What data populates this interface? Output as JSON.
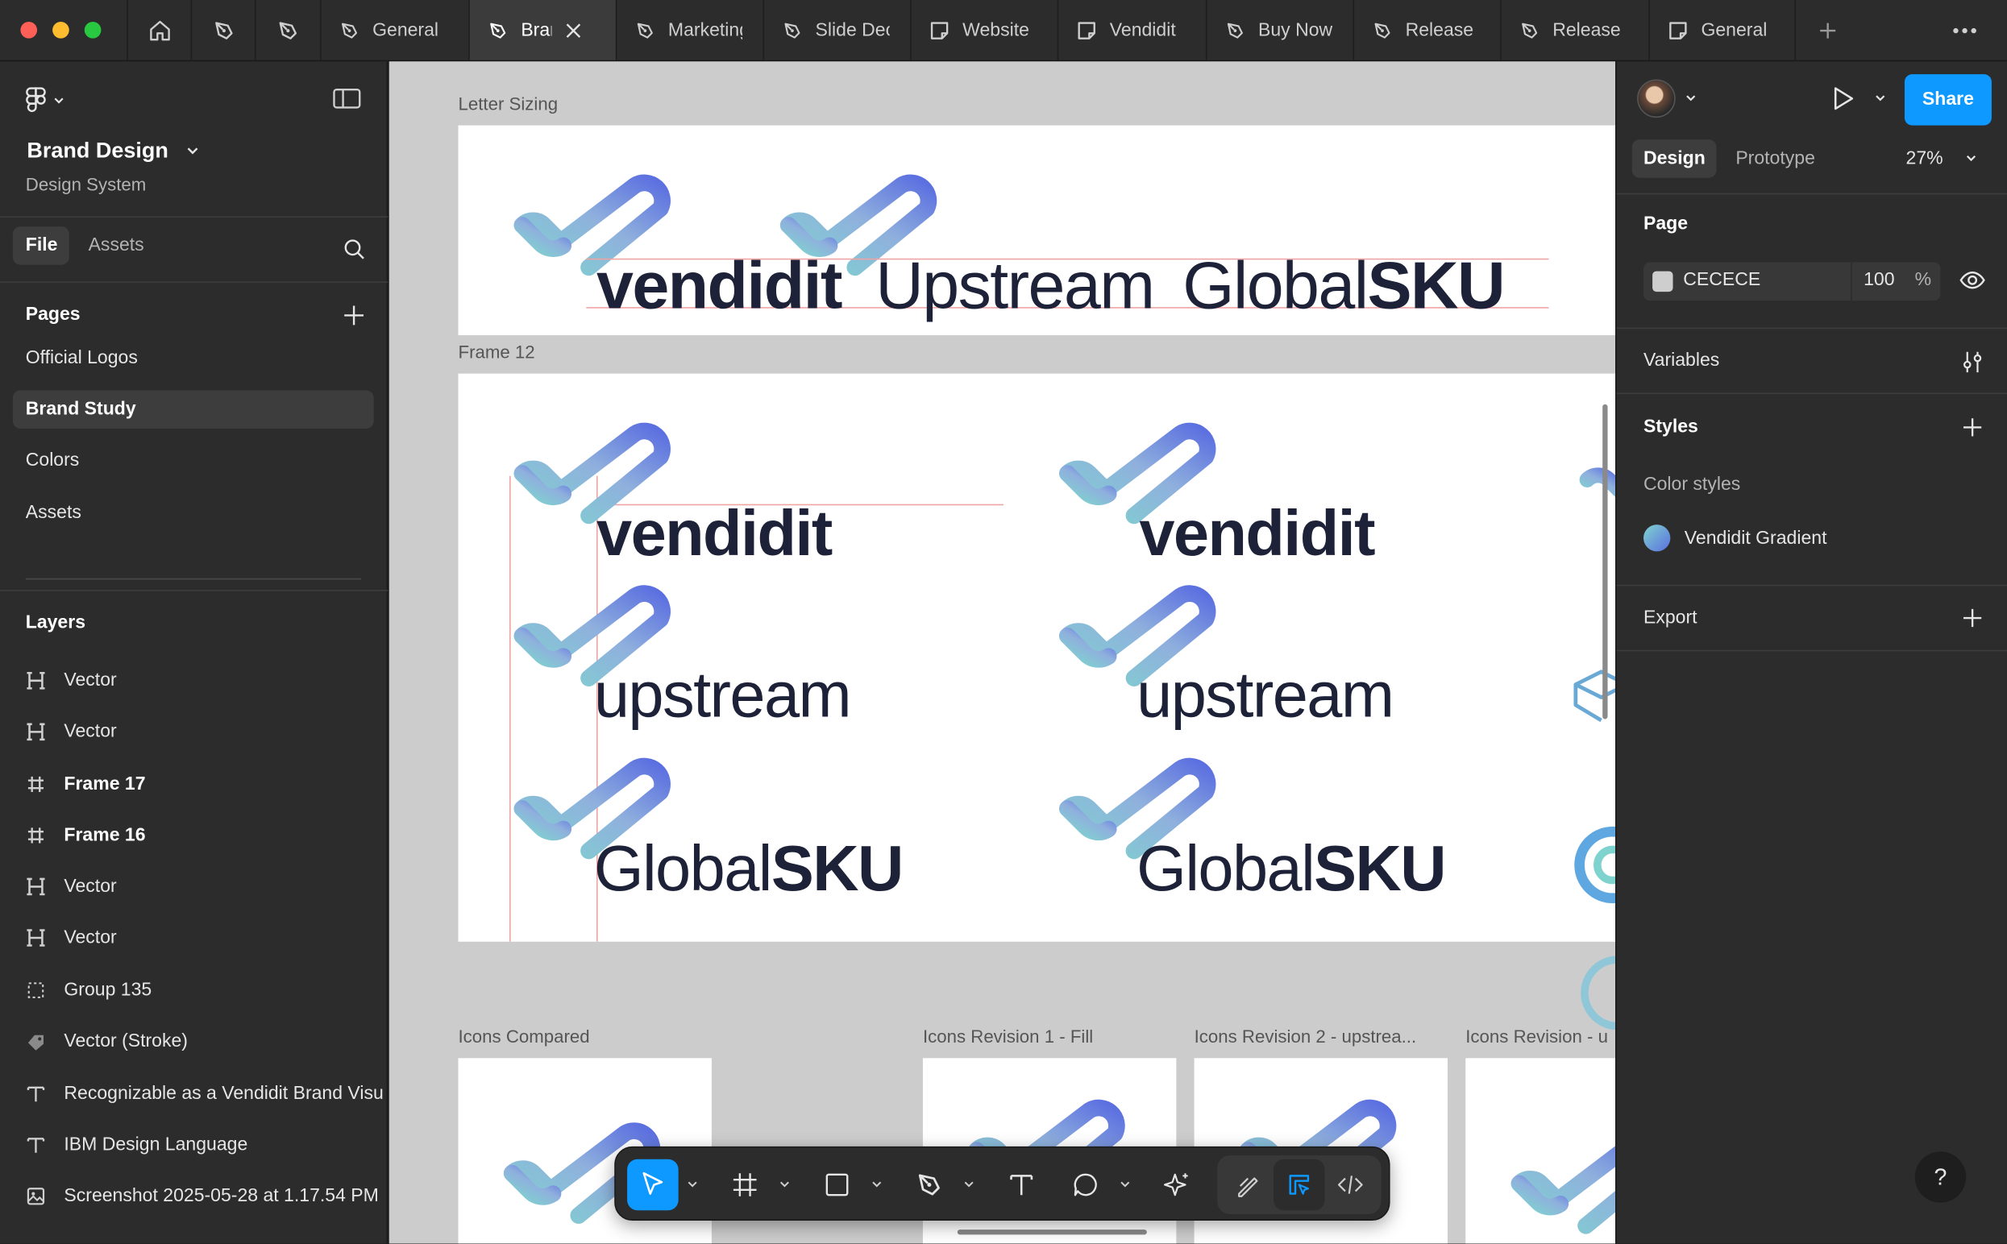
{
  "tabs": [
    {
      "label": "General",
      "kind": "design"
    },
    {
      "label": "Brand Design",
      "kind": "design",
      "active": true
    },
    {
      "label": "Marketing",
      "kind": "design"
    },
    {
      "label": "Slide Deck",
      "kind": "design"
    },
    {
      "label": "Website",
      "kind": "figjam"
    },
    {
      "label": "Vendidit",
      "kind": "figjam"
    },
    {
      "label": "Buy Now",
      "kind": "design"
    },
    {
      "label": "Release",
      "kind": "design"
    },
    {
      "label": "Release",
      "kind": "design"
    },
    {
      "label": "General",
      "kind": "figjam"
    }
  ],
  "left_panel": {
    "file_name": "Brand Design",
    "file_subtitle": "Design System",
    "tab_file": "File",
    "tab_assets": "Assets",
    "pages_title": "Pages",
    "pages": [
      "Official Logos",
      "Brand Study",
      "Colors",
      "Assets"
    ],
    "selected_page": "Brand Study",
    "layers_title": "Layers",
    "layers": [
      {
        "label": "Vector",
        "icon": "vector-icon"
      },
      {
        "label": "Vector",
        "icon": "vector-icon"
      },
      {
        "label": "Frame 17",
        "icon": "frame-icon"
      },
      {
        "label": "Frame 16",
        "icon": "frame-icon"
      },
      {
        "label": "Vector",
        "icon": "vector-icon"
      },
      {
        "label": "Vector",
        "icon": "vector-icon"
      },
      {
        "label": "Group 135",
        "icon": "group-icon"
      },
      {
        "label": "Vector (Stroke)",
        "icon": "stroke-icon"
      },
      {
        "label": "Recognizable as a Vendidit Brand Visu",
        "icon": "text-icon"
      },
      {
        "label": "IBM Design Language",
        "icon": "text-icon"
      },
      {
        "label": "Screenshot 2025-05-28 at 1.17.54 PM",
        "icon": "image-icon"
      }
    ]
  },
  "canvas": {
    "frames": {
      "letter_sizing": "Letter Sizing",
      "frame12": "Frame 12",
      "icons_compared": "Icons Compared",
      "icons_rev1": "Icons Revision 1 - Fill",
      "icons_rev2": "Icons Revision 2 - upstrea...",
      "icons_rev3": "Icons Revision - u"
    },
    "brand_words": {
      "vendidit": "vendidit",
      "upstream": "upstream",
      "upstream_cap": "Upstream",
      "global": "Global",
      "sku": "SKU"
    },
    "brand_gradient": [
      "#7fd3cf",
      "#5b6fe0"
    ],
    "wordmark_color": "#1d2238"
  },
  "right_panel": {
    "share_label": "Share",
    "tab_design": "Design",
    "tab_prototype": "Prototype",
    "zoom": "27%",
    "page_title": "Page",
    "page_color": "CECECE",
    "page_opacity": "100",
    "percent_sign": "%",
    "variables_title": "Variables",
    "styles_title": "Styles",
    "color_styles_title": "Color styles",
    "color_style_name": "Vendidit Gradient",
    "export_title": "Export"
  },
  "accent_color": "#0d99ff",
  "help_label": "?"
}
